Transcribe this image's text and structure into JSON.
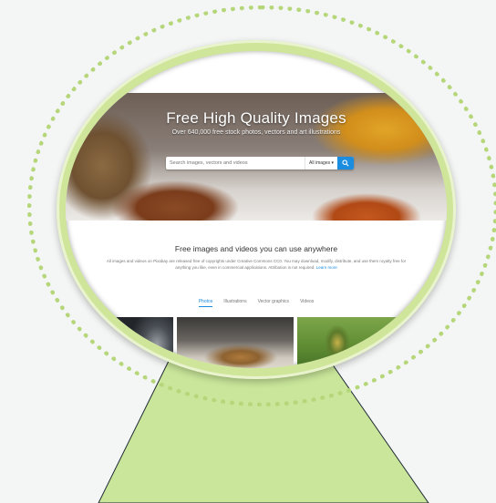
{
  "hero": {
    "title": "Free High Quality Images",
    "subtitle": "Over 640,000 free stock photos, vectors and art illustrations"
  },
  "search": {
    "placeholder": "Search images, vectors and videos",
    "type_label": "All images ▾"
  },
  "section": {
    "title": "Free images and videos you can use anywhere",
    "description": "All images and videos on Pixabay are released free of copyrights under Creative Commons CC0. You may download, modify, distribute, and use them royalty free for anything you like, even in commercial applications. Attribution is not required.",
    "learn_more": "Learn more"
  },
  "tabs": [
    {
      "label": "Photos"
    },
    {
      "label": "Illustrations"
    },
    {
      "label": "Vector graphics"
    },
    {
      "label": "Videos"
    }
  ],
  "colors": {
    "accent": "#1a8de0",
    "lens_fill": "#cfe59a",
    "dots": "#b6d67a",
    "stand": "#c9e69a"
  }
}
